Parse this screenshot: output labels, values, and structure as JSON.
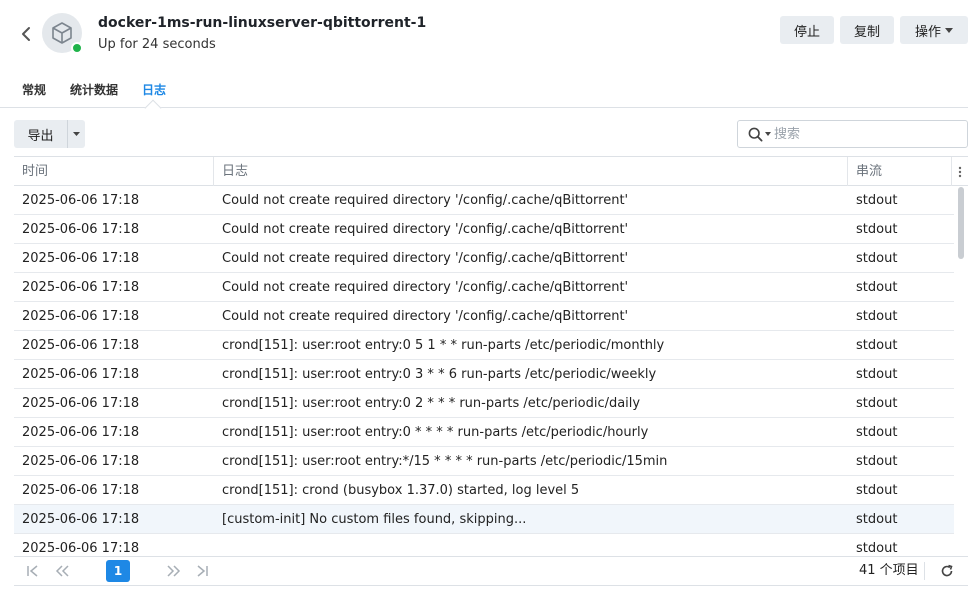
{
  "header": {
    "title": "docker-1ms-run-linuxserver-qbittorrent-1",
    "subtitle": "Up for 24 seconds",
    "stop_label": "停止",
    "copy_label": "复制",
    "action_label": "操作",
    "status_color": "#1fb34a"
  },
  "tabs": [
    {
      "label": "常规",
      "active": false
    },
    {
      "label": "统计数据",
      "active": false
    },
    {
      "label": "日志",
      "active": true
    }
  ],
  "toolbar": {
    "export_label": "导出",
    "search_placeholder": "搜索",
    "search_value": ""
  },
  "table": {
    "columns": {
      "time": "时间",
      "log": "日志",
      "stream": "串流"
    },
    "rows": [
      {
        "time": "2025-06-06 17:18",
        "log": "Could not create required directory '/config/.cache/qBittorrent'",
        "stream": "stdout"
      },
      {
        "time": "2025-06-06 17:18",
        "log": "Could not create required directory '/config/.cache/qBittorrent'",
        "stream": "stdout"
      },
      {
        "time": "2025-06-06 17:18",
        "log": "Could not create required directory '/config/.cache/qBittorrent'",
        "stream": "stdout"
      },
      {
        "time": "2025-06-06 17:18",
        "log": "Could not create required directory '/config/.cache/qBittorrent'",
        "stream": "stdout"
      },
      {
        "time": "2025-06-06 17:18",
        "log": "Could not create required directory '/config/.cache/qBittorrent'",
        "stream": "stdout"
      },
      {
        "time": "2025-06-06 17:18",
        "log": "crond[151]: user:root entry:0 5 1 * * run-parts /etc/periodic/monthly",
        "stream": "stdout"
      },
      {
        "time": "2025-06-06 17:18",
        "log": "crond[151]: user:root entry:0 3 * * 6 run-parts /etc/periodic/weekly",
        "stream": "stdout"
      },
      {
        "time": "2025-06-06 17:18",
        "log": "crond[151]: user:root entry:0 2 * * * run-parts /etc/periodic/daily",
        "stream": "stdout"
      },
      {
        "time": "2025-06-06 17:18",
        "log": "crond[151]: user:root entry:0 * * * * run-parts /etc/periodic/hourly",
        "stream": "stdout"
      },
      {
        "time": "2025-06-06 17:18",
        "log": "crond[151]: user:root entry:*/15 * * * * run-parts /etc/periodic/15min",
        "stream": "stdout"
      },
      {
        "time": "2025-06-06 17:18",
        "log": "crond[151]: crond (busybox 1.37.0) started, log level 5",
        "stream": "stdout"
      },
      {
        "time": "2025-06-06 17:18",
        "log": "[custom-init] No custom files found, skipping...",
        "stream": "stdout",
        "selected": true
      },
      {
        "time": "2025-06-06 17:18",
        "log": "",
        "stream": "stdout"
      }
    ]
  },
  "pagination": {
    "current_page": "1",
    "total_label": "41 个项目"
  }
}
